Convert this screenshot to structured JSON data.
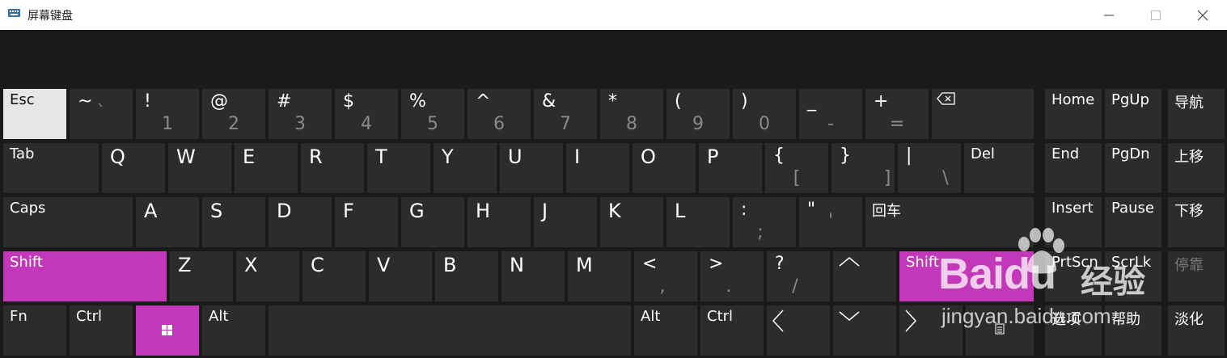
{
  "window": {
    "title": "屏幕键盘",
    "app_icon": "keyboard-icon",
    "minimize_icon": "minimize-icon",
    "maximize_icon": "maximize-icon",
    "close_icon": "close-icon"
  },
  "colors": {
    "key": "#2c2c2c",
    "background": "#1a1a1a",
    "accent": "#c238b9",
    "pressed": "#e6e6e6"
  },
  "row1": {
    "esc": "Esc",
    "tilde": {
      "top": "~",
      "bottom": "`"
    },
    "k1": {
      "top": "!",
      "bottom": "1"
    },
    "k2": {
      "top": "@",
      "bottom": "2"
    },
    "k3": {
      "top": "#",
      "bottom": "3"
    },
    "k4": {
      "top": "$",
      "bottom": "4"
    },
    "k5": {
      "top": "%",
      "bottom": "5"
    },
    "k6": {
      "top": "^",
      "bottom": "6"
    },
    "k7": {
      "top": "&",
      "bottom": "7"
    },
    "k8": {
      "top": "*",
      "bottom": "8"
    },
    "k9": {
      "top": "(",
      "bottom": "9"
    },
    "k0": {
      "top": ")",
      "bottom": "0"
    },
    "minus": {
      "top": "_",
      "bottom": "-"
    },
    "equal": {
      "top": "+",
      "bottom": "="
    },
    "backspace_icon": "backspace-icon",
    "home": "Home",
    "pgup": "PgUp",
    "nav": "导航"
  },
  "row2": {
    "tab": "Tab",
    "q": "Q",
    "w": "W",
    "e": "E",
    "r": "R",
    "t": "T",
    "y": "Y",
    "u": "U",
    "i": "I",
    "o": "O",
    "p": "P",
    "lbracket": {
      "top": "{",
      "bottom": "["
    },
    "rbracket": {
      "top": "}",
      "bottom": "]"
    },
    "backslash": {
      "top": "|",
      "bottom": "\\"
    },
    "del": "Del",
    "end": "End",
    "pgdn": "PgDn",
    "moveup": "上移"
  },
  "row3": {
    "caps": "Caps",
    "a": "A",
    "s": "S",
    "d": "D",
    "f": "F",
    "g": "G",
    "h": "H",
    "j": "J",
    "k": "K",
    "l": "L",
    "semicolon": {
      "top": ":",
      "bottom": ";"
    },
    "quote": {
      "top": "\"",
      "bottom": "'"
    },
    "enter": "回车",
    "insert": "Insert",
    "pause": "Pause",
    "movedown": "下移"
  },
  "row4": {
    "lshift": "Shift",
    "z": "Z",
    "x": "X",
    "c": "C",
    "v": "V",
    "b": "B",
    "n": "N",
    "m": "M",
    "comma": {
      "top": "<",
      "bottom": ","
    },
    "period": {
      "top": ">",
      "bottom": "."
    },
    "slash": {
      "top": "?",
      "bottom": "/"
    },
    "up_icon": "arrow-up-icon",
    "rshift": "Shift",
    "prtscn": "PrtScn",
    "scrlk": "ScrLk",
    "dock": "停靠"
  },
  "row5": {
    "fn": "Fn",
    "lctrl": "Ctrl",
    "win_icon": "windows-logo-icon",
    "lalt": "Alt",
    "ralt": "Alt",
    "rctrl": "Ctrl",
    "left_icon": "arrow-left-icon",
    "down_icon": "arrow-down-icon",
    "right_icon": "arrow-right-icon",
    "menu_icon": "context-menu-icon",
    "options": "选项",
    "help": "帮助",
    "fade": "淡化"
  },
  "watermark": {
    "brand": "Baidu",
    "cn": "经验",
    "url": "jingyan.baidu.com"
  }
}
